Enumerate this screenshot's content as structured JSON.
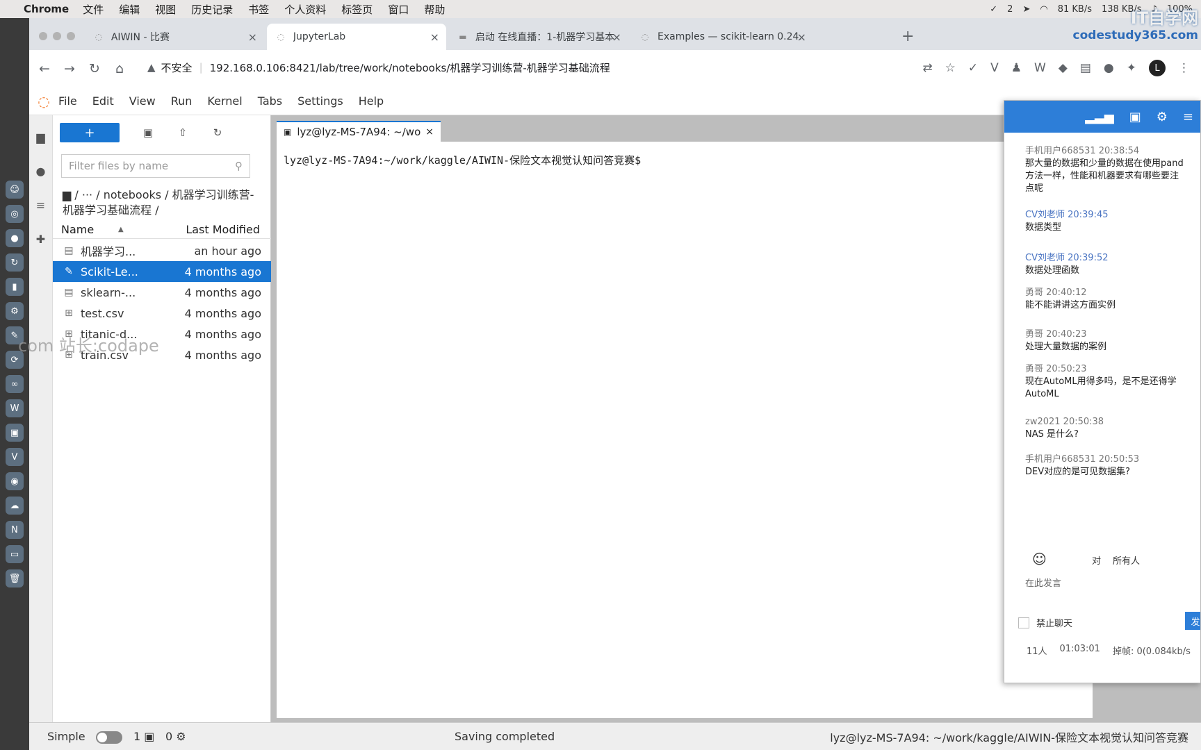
{
  "menubar": {
    "app": "Chrome",
    "items": [
      "文件",
      "编辑",
      "视图",
      "历史记录",
      "书签",
      "个人资料",
      "标签页",
      "窗口",
      "帮助"
    ],
    "status": [
      "2",
      "81 KB/s",
      "138 KB/s",
      "100%"
    ]
  },
  "tabs": [
    {
      "title": "AIWIN - 比赛",
      "close": "×"
    },
    {
      "title": "JupyterLab",
      "close": "×"
    },
    {
      "title": "启动 在线直播：1-机器学习基本",
      "close": "×"
    },
    {
      "title": "Examples — scikit-learn 0.24...",
      "close": "×"
    }
  ],
  "toolbar": {
    "security": "不安全",
    "url": "192.168.0.106:8421/lab/tree/work/notebooks/机器学习训练营-机器学习基础流程",
    "avatar": "L"
  },
  "jmenu": [
    "File",
    "Edit",
    "View",
    "Run",
    "Kernel",
    "Tabs",
    "Settings",
    "Help"
  ],
  "filebrowser": {
    "new_label": "+",
    "filter_placeholder": "Filter files by name",
    "breadcrumb": "/ ··· / notebooks / 机器学习训练营-机器学习基础流程 /",
    "col_name": "Name",
    "col_modified": "Last Modified",
    "files": [
      {
        "name": "机器学习...",
        "modified": "an hour ago",
        "icon": "notebook-icon"
      },
      {
        "name": "Scikit-Le...",
        "modified": "4 months ago",
        "icon": "pdf-icon"
      },
      {
        "name": "sklearn-...",
        "modified": "4 months ago",
        "icon": "notebook-icon"
      },
      {
        "name": "test.csv",
        "modified": "4 months ago",
        "icon": "csv-icon"
      },
      {
        "name": "titanic-d...",
        "modified": "4 months ago",
        "icon": "csv-icon"
      },
      {
        "name": "train.csv",
        "modified": "4 months ago",
        "icon": "csv-icon"
      }
    ]
  },
  "terminal": {
    "tab_title": "lyz@lyz-MS-7A94: ~/wo",
    "prompt": "lyz@lyz-MS-7A94:~/work/kaggle/AIWIN-保险文本视觉认知问答竞赛$"
  },
  "statusbar": {
    "simple": "Simple",
    "k1": "1",
    "k2": "0",
    "saving": "Saving completed",
    "path": "lyz@lyz-MS-7A94: ~/work/kaggle/AIWIN-保险文本视觉认知问答竞赛"
  },
  "chat": {
    "messages": [
      {
        "who": "手机用户668531 20:38:54",
        "text": "那大量的数据和少量的数据在使用pand\n方法一样，性能和机器要求有哪些要注\n点呢",
        "teacher": false
      },
      {
        "who": "CV刘老师 20:39:45",
        "text": "数据类型",
        "teacher": true
      },
      {
        "who": "CV刘老师 20:39:52",
        "text": "数据处理函数",
        "teacher": true
      },
      {
        "who": "勇哥 20:40:12",
        "text": "能不能讲讲这方面实例",
        "teacher": false
      },
      {
        "who": "勇哥 20:40:23",
        "text": "处理大量数据的案例",
        "teacher": false
      },
      {
        "who": "勇哥 20:50:23",
        "text": "现在AutoML用得多吗，是不是还得学\nAutoML",
        "teacher": false
      },
      {
        "who": "zw2021 20:50:38",
        "text": "NAS 是什么?",
        "teacher": false
      },
      {
        "who": "手机用户668531 20:50:53",
        "text": "DEV对应的是可见数据集?",
        "teacher": false
      }
    ],
    "to_label": "对",
    "to_value": "所有人",
    "compose_placeholder": "在此发言",
    "mute_label": "禁止聊天",
    "send_label": "发",
    "people": "11人",
    "time": "01:03:01",
    "loss": "掉帧: 0(0.084kb/s"
  },
  "watermark": {
    "main": "IT自学网",
    "sub": "codestudy365.com",
    "second": "com 站长:codape"
  }
}
